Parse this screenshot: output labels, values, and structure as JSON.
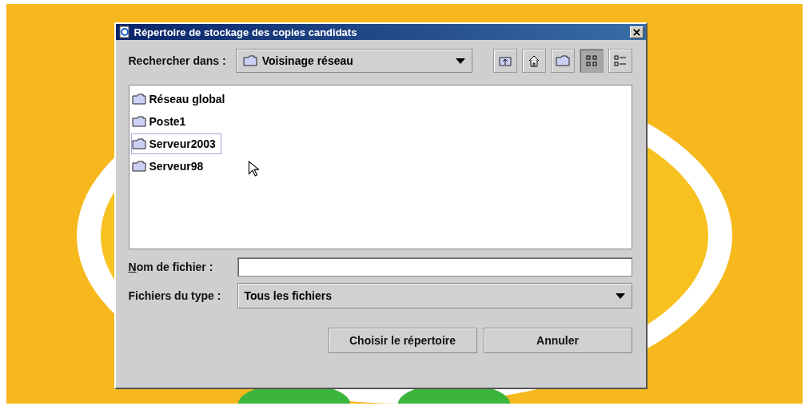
{
  "window": {
    "title": "Répertoire de stockage des copies candidats"
  },
  "look_in": {
    "label": "Rechercher dans :",
    "value": "Voisinage réseau"
  },
  "toolbar": [
    {
      "kind": "up",
      "selected": false
    },
    {
      "kind": "home",
      "selected": false
    },
    {
      "kind": "newfolder",
      "selected": false
    },
    {
      "kind": "list",
      "selected": true
    },
    {
      "kind": "details",
      "selected": false
    }
  ],
  "files": [
    {
      "name": "Réseau global",
      "selected": false
    },
    {
      "name": "Poste1",
      "selected": false
    },
    {
      "name": "Serveur2003",
      "selected": true
    },
    {
      "name": "Serveur98",
      "selected": false
    }
  ],
  "file_name": {
    "label": "Nom de fichier :"
  },
  "file_type": {
    "label": "Fichiers du type :",
    "value": "Tous les fichiers"
  },
  "buttons": [
    "Choisir le répertoire",
    "Annuler"
  ]
}
